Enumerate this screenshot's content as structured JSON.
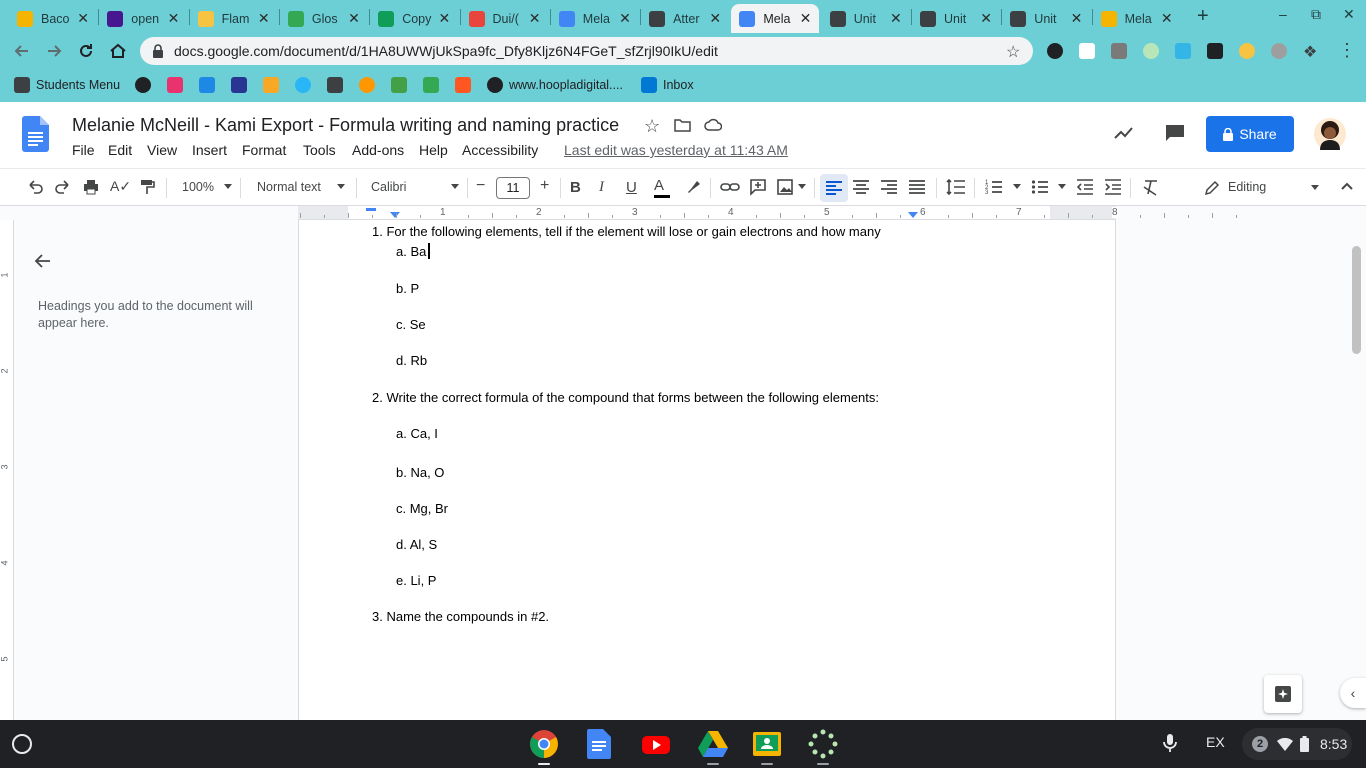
{
  "browser": {
    "tabs": [
      {
        "title": "Baco",
        "favicon": "slides-icon",
        "color": "#f4b400",
        "active": false
      },
      {
        "title": "open",
        "favicon": "kahoot-icon",
        "color": "#46178f",
        "active": false
      },
      {
        "title": "Flam",
        "favicon": "lightbulb-icon",
        "color": "#f6c342",
        "active": false
      },
      {
        "title": "Glos",
        "favicon": "drive-icon",
        "color": "#34a853",
        "active": false
      },
      {
        "title": "Copy",
        "favicon": "sheets-icon",
        "color": "#0f9d58",
        "active": false
      },
      {
        "title": "Dui/(",
        "favicon": "app-icon",
        "color": "#e8453c",
        "active": false
      },
      {
        "title": "Mela",
        "favicon": "docs-icon",
        "color": "#4285f4",
        "active": false
      },
      {
        "title": "Atter",
        "favicon": "classroom-icon",
        "color": "#3c4043",
        "active": false
      },
      {
        "title": "Mela",
        "favicon": "docs-icon",
        "color": "#4285f4",
        "active": true
      },
      {
        "title": "Unit",
        "favicon": "classroom-icon",
        "color": "#3c4043",
        "active": false
      },
      {
        "title": "Unit",
        "favicon": "classroom-icon",
        "color": "#3c4043",
        "active": false
      },
      {
        "title": "Unit",
        "favicon": "classroom-icon",
        "color": "#3c4043",
        "active": false
      },
      {
        "title": "Mela",
        "favicon": "slides-icon",
        "color": "#f4b400",
        "active": false
      }
    ],
    "url": "docs.google.com/document/d/1HA8UWWjUkSpa9fc_Dfy8Kljz6N4FGeT_sfZrjl90IkU/edit",
    "bookmarks": [
      {
        "label": "Students Menu",
        "icon": "folder-icon",
        "color": "#3c4043"
      },
      {
        "label": "",
        "icon": "globe-icon",
        "color": "#202124"
      },
      {
        "label": "",
        "icon": "n-icon",
        "color": "#e8336e"
      },
      {
        "label": "",
        "icon": "g-icon",
        "color": "#1e88e5"
      },
      {
        "label": "",
        "icon": "p-icon",
        "color": "#283593"
      },
      {
        "label": "",
        "icon": "leaf-icon",
        "color": "#f9a825"
      },
      {
        "label": "",
        "icon": "compass-icon",
        "color": "#29b6f6"
      },
      {
        "label": "",
        "icon": "folder-icon",
        "color": "#3c4043"
      },
      {
        "label": "",
        "icon": "circle-icon",
        "color": "#ff9800"
      },
      {
        "label": "",
        "icon": "b-icon",
        "color": "#43a047"
      },
      {
        "label": "",
        "icon": "drive-icon",
        "color": "#34a853"
      },
      {
        "label": "",
        "icon": "app-icon",
        "color": "#ff5722"
      },
      {
        "label": "www.hoopladigital....",
        "icon": "h-icon",
        "color": "#202124"
      },
      {
        "label": "Inbox",
        "icon": "outlook-icon",
        "color": "#0078d4"
      }
    ]
  },
  "docs": {
    "title": "Melanie McNeill - Kami Export - Formula writing and naming practice",
    "menus": [
      "File",
      "Edit",
      "View",
      "Insert",
      "Format",
      "Tools",
      "Add-ons",
      "Help",
      "Accessibility"
    ],
    "last_edit": "Last edit was yesterday at 11:43 AM",
    "share_label": "Share"
  },
  "toolbar": {
    "zoom": "100%",
    "style": "Normal text",
    "font": "Calibri",
    "font_size": "11",
    "mode": "Editing"
  },
  "ruler": {
    "marks": [
      "1",
      "2",
      "3",
      "4",
      "5",
      "6",
      "7",
      "8"
    ],
    "vmarks": [
      "1",
      "2",
      "3",
      "4",
      "5"
    ]
  },
  "outline": {
    "hint": "Headings you add to the document will appear here."
  },
  "document": {
    "q1": "1. For the following elements, tell if the element will lose or gain electrons and how many",
    "q1_items": [
      "a. Ba",
      "b. P",
      "c. Se",
      "d. Rb"
    ],
    "q2": "2. Write the correct formula of the compound that forms between the following elements:",
    "q2_items": [
      "a. Ca, I",
      "b. Na, O",
      "c. Mg, Br",
      "d. Al, S",
      "e. Li, P"
    ],
    "q3": "3. Name the compounds in #2."
  },
  "shelf": {
    "apps": [
      "chrome-icon",
      "docs-icon",
      "youtube-icon",
      "drive-icon",
      "classroom-icon",
      "launcher-dots-icon"
    ],
    "ime": "EX",
    "notifications": "2",
    "time": "8:53"
  }
}
